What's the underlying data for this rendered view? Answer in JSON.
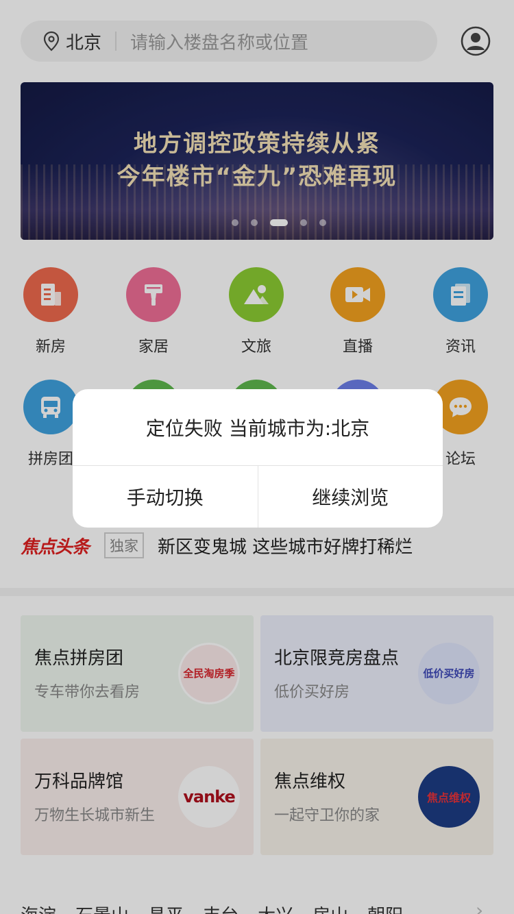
{
  "search": {
    "city": "北京",
    "placeholder": "请输入楼盘名称或位置"
  },
  "banner": {
    "line1": "地方调控政策持续从紧",
    "line2": "今年楼市“金九”恐难再现",
    "slides": 5,
    "active_slide": 3
  },
  "categories_row1": [
    {
      "label": "新房",
      "color": "#ee6a4e",
      "icon": "building-doc-icon"
    },
    {
      "label": "家居",
      "color": "#ef6e97",
      "icon": "paint-brush-icon"
    },
    {
      "label": "文旅",
      "color": "#8ccc33",
      "icon": "mountain-landscape-icon"
    },
    {
      "label": "直播",
      "color": "#f3a11f",
      "icon": "video-camera-icon"
    },
    {
      "label": "资讯",
      "color": "#3fa2de",
      "icon": "news-document-icon"
    }
  ],
  "categories_row2": [
    {
      "label": "拼房团",
      "color": "#3fa2de",
      "icon": "bus-icon"
    },
    {
      "label": "",
      "color": "#5fb84e",
      "icon": "hidden-icon"
    },
    {
      "label": "",
      "color": "#5fb84e",
      "icon": "hidden-icon"
    },
    {
      "label": "",
      "color": "#6c7ee8",
      "icon": "hidden-icon"
    },
    {
      "label": "论坛",
      "color": "#f3a11f",
      "icon": "chat-bubble-icon"
    }
  ],
  "news": {
    "logo": "焦点头条",
    "tag": "独家",
    "headline": "新区变鬼城 这些城市好牌打稀烂"
  },
  "cards": [
    {
      "title": "焦点拼房团",
      "subtitle": "专车带你去看房",
      "bg": "#eef6ee",
      "img_text": "全民淘房季"
    },
    {
      "title": "北京限竞房盘点",
      "subtitle": "低价买好房",
      "bg": "#eceefa",
      "img_text": "低价买好房"
    },
    {
      "title": "万科品牌馆",
      "subtitle": "万物生长城市新生",
      "bg": "#f9eeec",
      "img_text": "vanke"
    },
    {
      "title": "焦点维权",
      "subtitle": "一起守卫你的家",
      "bg": "#f7f2ea",
      "img_text": "焦点维权"
    }
  ],
  "districts": [
    "海淀",
    "石景山",
    "昌平",
    "丰台",
    "大兴",
    "房山",
    "朝阳"
  ],
  "dialog": {
    "message": "定位失败 当前城市为:北京",
    "left_button": "手动切换",
    "right_button": "继续浏览"
  }
}
